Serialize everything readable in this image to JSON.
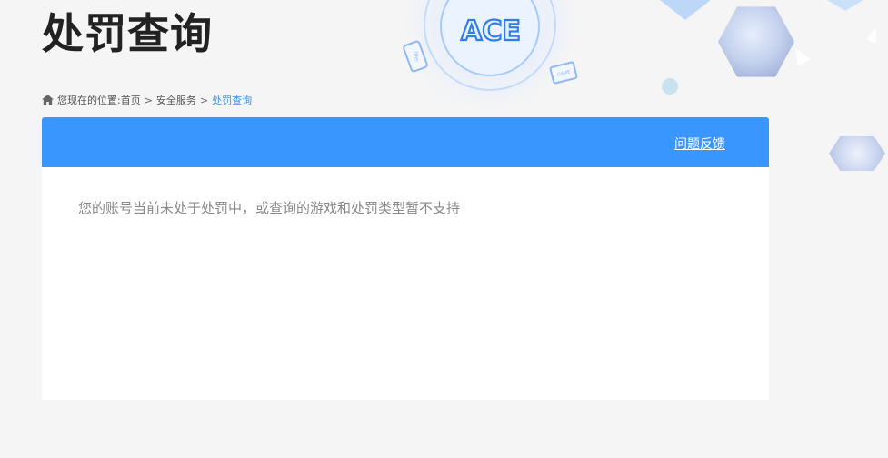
{
  "page": {
    "title": "处罚查询"
  },
  "breadcrumb": {
    "prefix": "您现在的位置:",
    "items": [
      {
        "label": "首页"
      },
      {
        "label": "安全服务"
      },
      {
        "label": "处罚查询"
      }
    ],
    "separator": ">"
  },
  "header_art": {
    "logo_text": "ACE",
    "phone_text": "GAME",
    "monitor_text": "GAME"
  },
  "panel": {
    "feedback_link": "问题反馈",
    "message": "您的账号当前未处于处罚中，或查询的游戏和处罚类型暂不支持"
  },
  "colors": {
    "accent": "#3996ff",
    "breadcrumb_current": "#3a8ee6",
    "background": "#f5f5f5",
    "message_text": "#888888"
  },
  "icons": {
    "breadcrumb_home": "home-icon"
  }
}
